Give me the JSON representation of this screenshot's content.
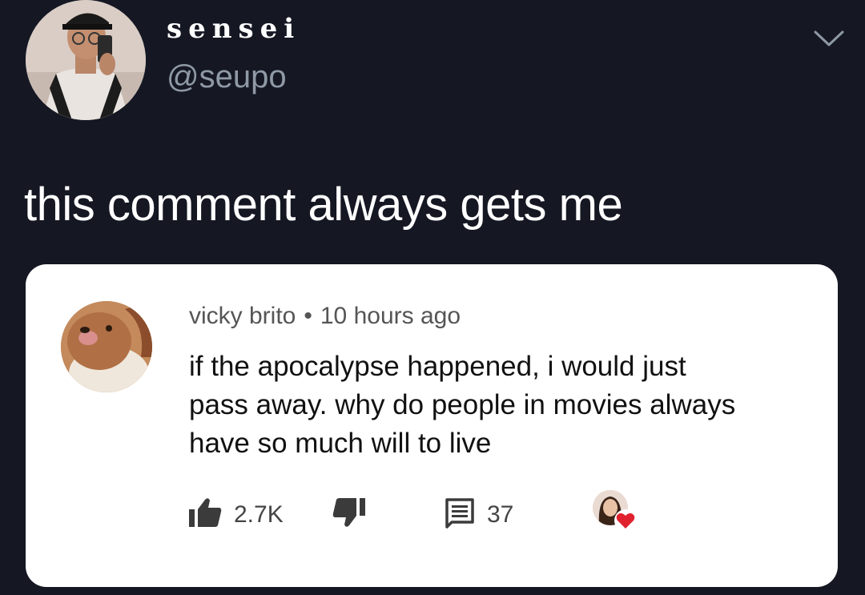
{
  "tweet": {
    "display_name": "sensei",
    "handle": "@seupo",
    "text": "this comment always gets me",
    "menu_icon": "chevron-down-icon"
  },
  "comment": {
    "author": "vicky brito",
    "separator": "•",
    "time": "10 hours ago",
    "body_lines": [
      "if the apocalypse happened, i would just",
      "pass away. why do people in movies always",
      "have so much will to live"
    ],
    "likes": "2.7K",
    "replies": "37",
    "icons": {
      "like": "thumbs-up-icon",
      "dislike": "thumbs-down-icon",
      "reply": "comment-icon",
      "creator_heart": "heart-icon"
    }
  },
  "colors": {
    "background": "#151823",
    "card": "#ffffff",
    "handle": "#8f99a6",
    "heart": "#e0222f"
  }
}
